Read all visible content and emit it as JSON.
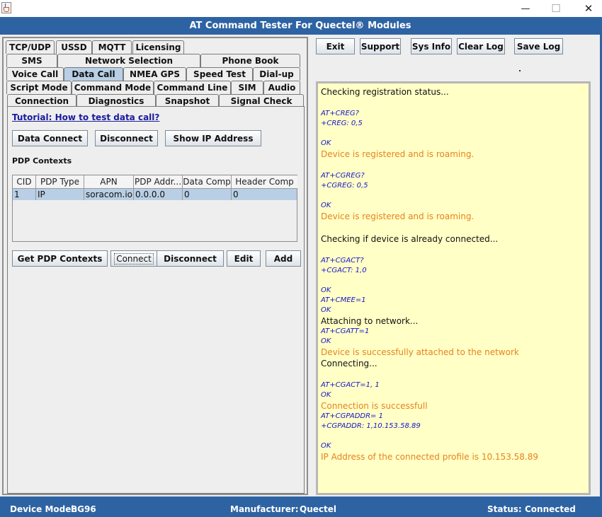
{
  "window": {
    "title": "AT Command Tester For Quectel® Modules",
    "minimize_glyph": "—",
    "maximize_glyph": "☐",
    "close_glyph": "✕",
    "app_icon": "java-icon"
  },
  "tabs": {
    "row1": [
      "TCP/UDP",
      "USSD",
      "MQTT",
      "Licensing"
    ],
    "row2": [
      "SMS",
      "Network Selection",
      "Phone Book"
    ],
    "row3": [
      "Voice Call",
      "Data Call",
      "NMEA GPS",
      "Speed Test",
      "Dial-up"
    ],
    "row4": [
      "Script Mode",
      "Command Mode",
      "Command Line",
      "SIM",
      "Audio"
    ],
    "row5": [
      "Connection",
      "Diagnostics",
      "Snapshot",
      "Signal Check"
    ],
    "selected": "Data Call"
  },
  "data_call": {
    "tutorial_link": "Tutorial: How to test data call?",
    "buttons": {
      "data_connect": "Data Connect",
      "disconnect": "Disconnect",
      "show_ip": "Show IP Address"
    },
    "pdp_section_label": "PDP Contexts",
    "pdp_table": {
      "columns": [
        "CID",
        "PDP Type",
        "APN",
        "PDP Addr...",
        "Data Comp",
        "Header Comp"
      ],
      "rows": [
        [
          "1",
          "IP",
          "soracom.io",
          "0.0.0.0",
          "0",
          "0"
        ]
      ]
    },
    "pdp_buttons": {
      "get_contexts": "Get PDP Contexts",
      "connect": "Connect",
      "disconnect": "Disconnect",
      "edit": "Edit",
      "add": "Add"
    }
  },
  "toolbar": {
    "exit": "Exit",
    "support": "Support",
    "sys_info": "Sys Info",
    "clear_log": "Clear Log",
    "save_log": "Save Log"
  },
  "log": {
    "colors": {
      "info": "#111111",
      "command": "#1515cc",
      "result": "#e8821e"
    },
    "lines": [
      {
        "text": "Checking registration status...",
        "kind": "info"
      },
      {
        "text": "AT+CREG?",
        "kind": "command"
      },
      {
        "text": "+CREG: 0,5",
        "kind": "command"
      },
      {
        "text": "OK",
        "kind": "command"
      },
      {
        "text": "Device is registered and is roaming.",
        "kind": "result"
      },
      {
        "text": "AT+CGREG?",
        "kind": "command"
      },
      {
        "text": "+CGREG: 0,5",
        "kind": "command"
      },
      {
        "text": "OK",
        "kind": "command"
      },
      {
        "text": "Device is registered and is roaming.",
        "kind": "result"
      },
      {
        "text": "Checking if device is already connected...",
        "kind": "info"
      },
      {
        "text": "AT+CGACT?",
        "kind": "command"
      },
      {
        "text": "+CGACT: 1,0",
        "kind": "command"
      },
      {
        "text": "OK",
        "kind": "command"
      },
      {
        "text": "AT+CMEE=1",
        "kind": "command"
      },
      {
        "text": "OK",
        "kind": "command"
      },
      {
        "text": "Attaching to network...",
        "kind": "info"
      },
      {
        "text": "AT+CGATT=1",
        "kind": "command"
      },
      {
        "text": "OK",
        "kind": "command"
      },
      {
        "text": "Device is successfully attached to the network",
        "kind": "result"
      },
      {
        "text": "Connecting...",
        "kind": "info"
      },
      {
        "text": "AT+CGACT=1, 1",
        "kind": "command"
      },
      {
        "text": "OK",
        "kind": "command"
      },
      {
        "text": "Connection is successfull",
        "kind": "result"
      },
      {
        "text": "AT+CGPADDR= 1",
        "kind": "command"
      },
      {
        "text": "+CGPADDR: 1,10.153.58.89",
        "kind": "command"
      },
      {
        "text": "OK",
        "kind": "command"
      },
      {
        "text": "IP Address of the connected profile is 10.153.58.89",
        "kind": "result"
      }
    ]
  },
  "status_bar": {
    "device_model_label": "Device Model:",
    "device_model_value": "BG96",
    "manufacturer_label": "Manufacturer:",
    "manufacturer_value": "Quectel",
    "status_label": "Status:",
    "status_value": "Connected"
  }
}
